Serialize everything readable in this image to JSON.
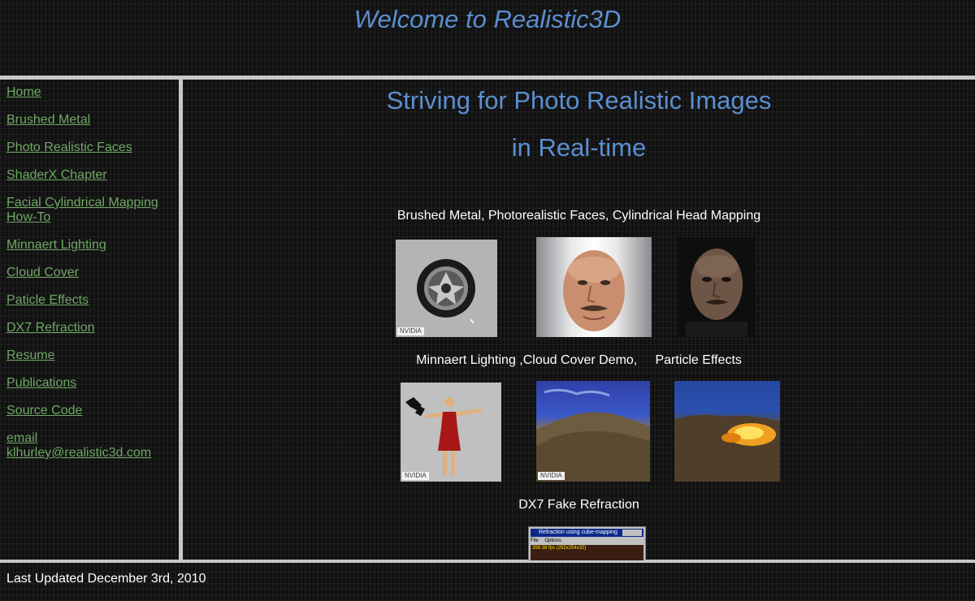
{
  "header": {
    "title": "Welcome to Realistic3D"
  },
  "sidebar": {
    "links": [
      {
        "label": "Home",
        "name": "nav-home"
      },
      {
        "label": "Brushed Metal",
        "name": "nav-brushed-metal"
      },
      {
        "label": "Photo Realistic Faces",
        "name": "nav-photo-realistic-faces"
      },
      {
        "label": "ShaderX Chapter",
        "name": "nav-shaderx-chapter"
      },
      {
        "label": "Facial Cylindrical Mapping How-To",
        "name": "nav-facial-cylindrical-mapping"
      },
      {
        "label": "Minnaert Lighting",
        "name": "nav-minnaert-lighting"
      },
      {
        "label": "Cloud Cover",
        "name": "nav-cloud-cover"
      },
      {
        "label": "Paticle Effects",
        "name": "nav-particle-effects"
      },
      {
        "label": "DX7 Refraction",
        "name": "nav-dx7-refraction"
      },
      {
        "label": "Resume",
        "name": "nav-resume"
      },
      {
        "label": "Publications",
        "name": "nav-publications"
      },
      {
        "label": "Source Code",
        "name": "nav-source-code"
      },
      {
        "label": "email klhurley@realistic3d.com",
        "name": "nav-email"
      }
    ]
  },
  "main": {
    "headline_1": "Striving for Photo Realistic Images",
    "headline_2": "in Real-time",
    "caption_1": "Brushed Metal, Photorealistic Faces, Cylindrical Head Mapping",
    "caption_2": "Minnaert Lighting ,Cloud Cover Demo,     Particle Effects",
    "caption_3": "DX7 Fake Refraction",
    "nvidia_badge": "NVIDIA",
    "refraction_window": {
      "title": "Refraction using cube-mapping",
      "menu_file": "File",
      "menu_options": "Options",
      "fps": "358.38 fps (292x254x32)"
    }
  },
  "footer": {
    "text": "Last Updated December 3rd, 2010"
  },
  "colors": {
    "title_blue": "#5b8fd0",
    "link_green": "#6ea864",
    "divider": "#c8c8c8",
    "background": "#101010"
  }
}
